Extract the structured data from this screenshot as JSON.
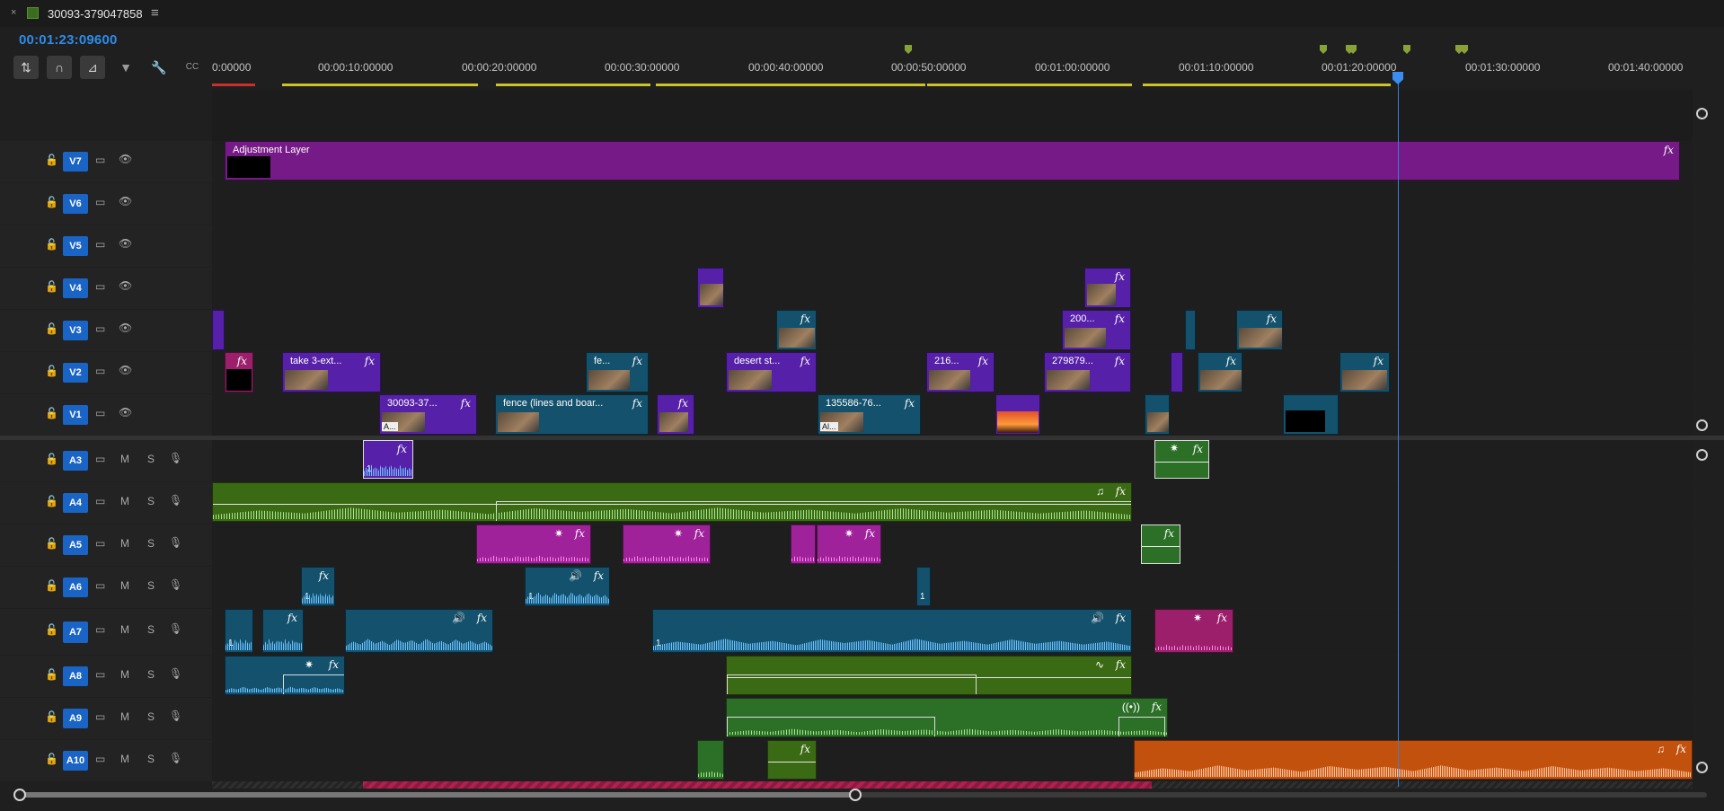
{
  "tab": {
    "close_icon": "×",
    "title": "30093-379047858",
    "menu_icon": "≡"
  },
  "timecode": "00:01:23:09600",
  "tools": [
    {
      "name": "insert-sequence-nested",
      "icon": "⇅"
    },
    {
      "name": "snap",
      "icon": "∩"
    },
    {
      "name": "linked-selection",
      "icon": "⊿"
    },
    {
      "name": "add-marker",
      "icon": "▼"
    },
    {
      "name": "timeline-settings",
      "icon": "🔧"
    },
    {
      "name": "captions",
      "icon": "CC"
    }
  ],
  "ruler": {
    "labels": [
      "0:00000",
      "00:00:10:00000",
      "00:00:20:00000",
      "00:00:30:00000",
      "00:00:40:00000",
      "00:00:50:00000",
      "00:01:00:00000",
      "00:01:10:00000",
      "00:01:20:00000",
      "00:01:30:00000",
      "00:01:40:00000"
    ]
  },
  "video_tracks": [
    {
      "name": "V7"
    },
    {
      "name": "V6"
    },
    {
      "name": "V5"
    },
    {
      "name": "V4"
    },
    {
      "name": "V3"
    },
    {
      "name": "V2"
    },
    {
      "name": "V1"
    }
  ],
  "audio_tracks": [
    {
      "name": "A3",
      "m": "M",
      "s": "S"
    },
    {
      "name": "A4",
      "m": "M",
      "s": "S"
    },
    {
      "name": "A5",
      "m": "M",
      "s": "S"
    },
    {
      "name": "A6",
      "m": "M",
      "s": "S"
    },
    {
      "name": "A7",
      "m": "M",
      "s": "S"
    },
    {
      "name": "A8",
      "m": "M",
      "s": "S"
    },
    {
      "name": "A9",
      "m": "M",
      "s": "S"
    },
    {
      "name": "A10",
      "m": "M",
      "s": "S"
    }
  ],
  "clip_labels": {
    "adjustment": "Adjustment Layer",
    "take3": "take 3-ext...",
    "fe": "fe...",
    "desert": "desert st...",
    "c216": "216...",
    "c279": "279879...",
    "c200": "200...",
    "c30093": "30093-37...",
    "fence": "fence (lines and boar...",
    "c135586": "135586-76...",
    "fx": "fx",
    "one": "1",
    "a_short": "A...",
    "al": "Al..."
  },
  "colors": {
    "accent": "#2d8ceb",
    "playhead": "#3a7fd6",
    "track_name_bg": "#1a64c6",
    "adjustment": "#751a86",
    "video_purple": "#5620a8",
    "video_teal": "#13516c",
    "audio_green": "#3b6a14",
    "audio_orange": "#c2510e"
  },
  "icons": {
    "lock": "lock-icon",
    "toggle_output": "film-icon",
    "visibility": "eye-icon",
    "mute": "M",
    "solo": "S",
    "voice": "mic-icon",
    "music": "music-note-icon",
    "sparkle": "effect-star-icon"
  }
}
